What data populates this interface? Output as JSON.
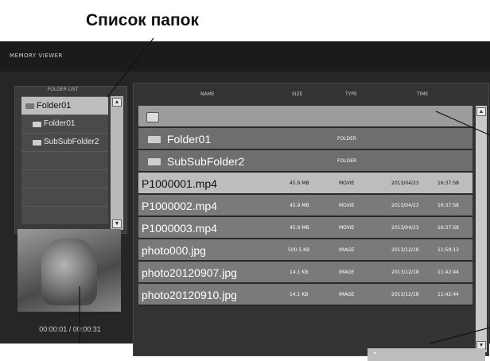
{
  "annotation": {
    "title": "Список папок"
  },
  "app": {
    "title": "MEMORY VIEWER"
  },
  "folder_panel": {
    "header": "FOLDER LIST",
    "items": [
      {
        "label": "Folder01",
        "selected": true
      },
      {
        "label": "Folder01",
        "selected": false
      },
      {
        "label": "SubSubFolder2",
        "selected": false
      },
      {
        "label": "",
        "selected": false
      },
      {
        "label": "",
        "selected": false
      },
      {
        "label": "",
        "selected": false
      },
      {
        "label": "",
        "selected": false
      }
    ],
    "timecode": "00:00:01 / 00:00:31"
  },
  "file_table": {
    "columns": {
      "name": "NAME",
      "size": "SIZE",
      "type": "TYPE",
      "time": "TIME"
    },
    "rows": [
      {
        "kind": "up",
        "name": "",
        "size": "",
        "type": "",
        "date": "",
        "time": ""
      },
      {
        "kind": "folder",
        "name": "Folder01",
        "size": "",
        "type": "FOLDER",
        "date": "",
        "time": ""
      },
      {
        "kind": "folder",
        "name": "SubSubFolder2",
        "size": "",
        "type": "FOLDER",
        "date": "",
        "time": ""
      },
      {
        "kind": "file",
        "selected": true,
        "name": "P1000001.mp4",
        "size": "45.9 MB",
        "type": "MOVIE",
        "date": "2013/04/23",
        "time": "16:37:58"
      },
      {
        "kind": "file",
        "name": "P1000002.mp4",
        "size": "45.9 MB",
        "type": "MOVIE",
        "date": "2013/04/23",
        "time": "16:37:58"
      },
      {
        "kind": "file",
        "name": "P1000003.mp4",
        "size": "45.9 MB",
        "type": "MOVIE",
        "date": "2013/04/23",
        "time": "16:37:58"
      },
      {
        "kind": "file",
        "name": "photo000.jpg",
        "size": "500.5 KB",
        "type": "IMAGE",
        "date": "2013/12/18",
        "time": "11:59:12"
      },
      {
        "kind": "file",
        "name": "photo20120907.jpg",
        "size": "14.1 KB",
        "type": "IMAGE",
        "date": "2013/12/18",
        "time": "11:42:44"
      },
      {
        "kind": "file",
        "name": "photo20120910.jpg",
        "size": "14.1 KB",
        "type": "IMAGE",
        "date": "2013/12/18",
        "time": "11:42:44"
      }
    ]
  },
  "icons": [
    "folder-icon",
    "up-folder-icon",
    "scroll-up-icon",
    "scroll-down-icon"
  ],
  "colors": {
    "background": "#262626",
    "selected_row": "#bdbdbd",
    "row": "#7a7a7a"
  }
}
